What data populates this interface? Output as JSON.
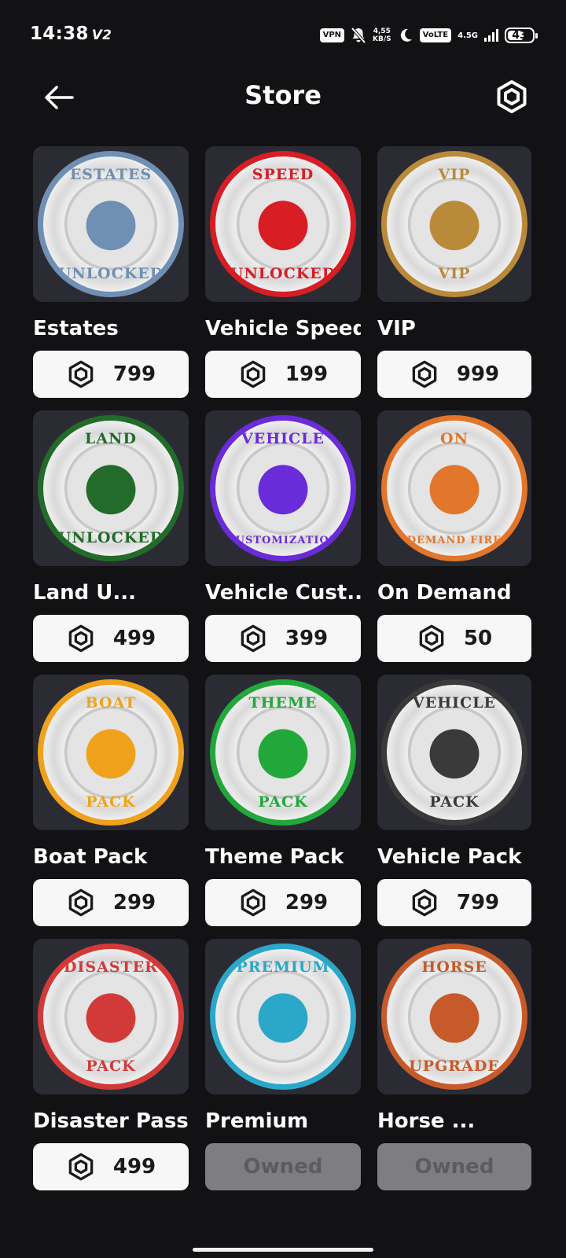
{
  "status_bar": {
    "time": "14:38",
    "carrier_tag": "V2",
    "vpn": "VPN",
    "speed_value": "4,55",
    "speed_unit": "KB/S",
    "volte": "VoLTE",
    "network": "4.5G",
    "battery": "43"
  },
  "header": {
    "title": "Store",
    "back_icon": "arrow-left-icon",
    "currency_icon": "robux-icon"
  },
  "items": [
    {
      "name": "Estates",
      "price": "799",
      "badge_top": "ESTATES",
      "badge_bottom": "UNLOCKED",
      "color": "#6f8fb3"
    },
    {
      "name": "Vehicle Speed",
      "price": "199",
      "badge_top": "SPEED",
      "badge_bottom": "UNLOCKED",
      "color": "#d81d24"
    },
    {
      "name": "VIP",
      "price": "999",
      "badge_top": "VIP",
      "badge_bottom": "VIP",
      "color": "#b98a3a"
    },
    {
      "name": "Land U...",
      "price": "499",
      "badge_top": "LAND",
      "badge_bottom": "UNLOCKED",
      "color": "#226b2a"
    },
    {
      "name": "Vehicle Cust...",
      "price": "399",
      "badge_top": "VEHICLE",
      "badge_bottom": "CUSTOMIZATION",
      "color": "#6a2bd8"
    },
    {
      "name": "On Demand",
      "price": "50",
      "badge_top": "ON",
      "badge_bottom": "DEMAND FIRE",
      "color": "#e2762b"
    },
    {
      "name": "Boat Pack",
      "price": "299",
      "badge_top": "BOAT",
      "badge_bottom": "PACK",
      "color": "#f0a21c"
    },
    {
      "name": "Theme Pack",
      "price": "299",
      "badge_top": "THEME",
      "badge_bottom": "PACK",
      "color": "#22a83a"
    },
    {
      "name": "Vehicle Pack",
      "price": "799",
      "badge_top": "VEHICLE",
      "badge_bottom": "PACK",
      "color": "#3a3a3a"
    },
    {
      "name": "Disaster Pass",
      "price": "499",
      "badge_top": "DISASTER",
      "badge_bottom": "PACK",
      "color": "#d23a3a"
    },
    {
      "name": "Premium",
      "price": "Owned",
      "owned": true,
      "badge_top": "PREMIUM",
      "badge_bottom": "",
      "color": "#2aa7c9"
    },
    {
      "name": "Horse ...",
      "price": "Owned",
      "owned": true,
      "badge_top": "HORSE",
      "badge_bottom": "UPGRADE",
      "color": "#c75a2a"
    }
  ]
}
